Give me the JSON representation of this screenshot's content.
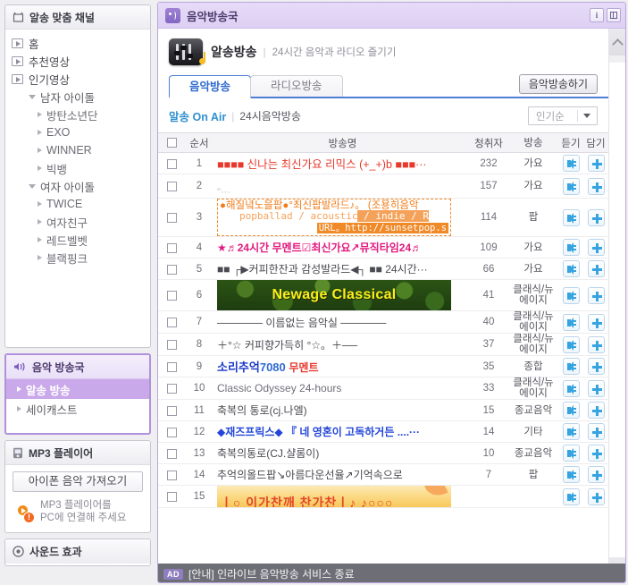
{
  "sidebar": {
    "channel_panel": {
      "title": "알송 맞춤 채널",
      "icon": "tv-icon",
      "items": [
        {
          "label": "홈",
          "level": 0,
          "icon": "tv-icon"
        },
        {
          "label": "추천영상",
          "level": 0,
          "icon": "tv-icon"
        },
        {
          "label": "인기영상",
          "level": 0,
          "icon": "tv-icon"
        },
        {
          "label": "남자 아이돌",
          "level": 1,
          "icon": "triangle-down-icon"
        },
        {
          "label": "방탄소년단",
          "level": 2,
          "icon": "triangle-right-icon"
        },
        {
          "label": "EXO",
          "level": 2,
          "icon": "triangle-right-icon"
        },
        {
          "label": "WINNER",
          "level": 2,
          "icon": "triangle-right-icon"
        },
        {
          "label": "빅뱅",
          "level": 2,
          "icon": "triangle-right-icon"
        },
        {
          "label": "여자 아이돌",
          "level": 1,
          "icon": "triangle-down-icon"
        },
        {
          "label": "TWICE",
          "level": 2,
          "icon": "triangle-right-icon"
        },
        {
          "label": "여자친구",
          "level": 2,
          "icon": "triangle-right-icon"
        },
        {
          "label": "레드벨벳",
          "level": 2,
          "icon": "triangle-right-icon"
        },
        {
          "label": "블랙핑크",
          "level": 2,
          "icon": "triangle-right-icon"
        }
      ]
    },
    "station_panel": {
      "title": "음악 방송국",
      "icon": "speaker-wave-icon",
      "items": [
        {
          "label": "알송 방송",
          "active": true
        },
        {
          "label": "세이캐스트",
          "active": false
        }
      ]
    },
    "mp3_panel": {
      "title": "MP3 플레이어",
      "icon": "mp3-device-icon",
      "import_button": "아이폰 음악 가져오기",
      "message_line1": "MP3 플레이어를",
      "message_line2": "PC에 연결해 주세요",
      "warn_glyph": "!"
    },
    "sound_panel": {
      "title": "사운드 효과",
      "icon": "sound-disc-icon"
    }
  },
  "main": {
    "window_title": "음악방송국",
    "window_buttons": [
      {
        "name": "info-button",
        "glyph": "i"
      },
      {
        "name": "layout-button",
        "glyph": ""
      }
    ],
    "station": {
      "name": "알송방송",
      "divider": "|",
      "description": "24시간 음악과 라디오 즐기기"
    },
    "tabs": [
      {
        "label": "음악방송",
        "active": true
      },
      {
        "label": "라디오방송",
        "active": false
      }
    ],
    "broadcast_button": "음악방송하기",
    "onair": {
      "label": "알송 On Air",
      "divider": "|",
      "subtitle": "24시음악방송"
    },
    "sort_select": {
      "value": "인기순"
    },
    "table": {
      "headers": {
        "check": "",
        "order": "순서",
        "name": "방송명",
        "listeners": "청취자",
        "category": "방송",
        "play": "듣기",
        "save": "담기"
      },
      "rows": [
        {
          "order": "1",
          "style": "red",
          "title": "■■■■ 신나는 최신가요 리믹스 (+_+)b ■■■···",
          "listeners": "232",
          "category": "가요"
        },
        {
          "order": "2",
          "style": "quiet",
          "title": "\"···",
          "listeners": "157",
          "category": "가요"
        },
        {
          "order": "3",
          "style": "orange-box",
          "line1": "●해질녘노을팝●°최신팝발라드♪。 (조용히음악",
          "line2_plain": "popballad / acoustic",
          "line2_hl": " / indie / R",
          "line3": "URL。http://sunsetpop.s",
          "listeners": "114",
          "category": "팝"
        },
        {
          "order": "4",
          "style": "magenta",
          "title": "★♬24시간 무멘트☑최신가요↗뮤직타임24♬",
          "listeners": "109",
          "category": "가요"
        },
        {
          "order": "5",
          "style": "dark",
          "title": "■■ ┌▶커피한잔과 감성발라드◀┐ ■■ 24시간···",
          "listeners": "66",
          "category": "가요"
        },
        {
          "order": "6",
          "style": "banner-newage",
          "title": "Newage Classical",
          "listeners": "41",
          "category": "클래식/뉴에이지"
        },
        {
          "order": "7",
          "style": "dark",
          "title": "────── 이름없는 음악실 ──────",
          "listeners": "40",
          "category": "클래식/뉴에이지"
        },
        {
          "order": "8",
          "style": "dark",
          "title": "＋°☆ 커피향가득히 °☆。＋──",
          "listeners": "37",
          "category": "클래식/뉴에이지"
        },
        {
          "order": "9",
          "style": "blue-big",
          "title_blue": "소리추억",
          "title_num": "7080",
          "title_red": "무멘트",
          "listeners": "35",
          "category": "종합"
        },
        {
          "order": "10",
          "style": "gray",
          "title": "Classic Odyssey 24-hours",
          "listeners": "33",
          "category": "클래식/뉴에이지"
        },
        {
          "order": "11",
          "style": "dark",
          "title": "축복의 통로(cj.나엘)",
          "listeners": "15",
          "category": "종교음악"
        },
        {
          "order": "12",
          "style": "blue-bold",
          "title": "◆재즈프릭스◆ 『 네 영혼이 고독하거든 ....···",
          "listeners": "14",
          "category": "기타"
        },
        {
          "order": "13",
          "style": "dark",
          "title": "축복의통로(CJ.샬롬이)",
          "listeners": "10",
          "category": "종교음악"
        },
        {
          "order": "14",
          "style": "dark",
          "title": "추억의올드팝↘아름다운선율↗기억속으로",
          "listeners": "7",
          "category": "팝"
        },
        {
          "order": "15",
          "style": "banner-last",
          "title": "ㅣ○ 이가찬깨 찬가찬ㅣ♪ ♪○○○",
          "listeners": "",
          "category": ""
        }
      ]
    }
  },
  "statusbar": {
    "badge": "AD",
    "message": "[안내] 인라이브 음악방송 서비스 종료"
  },
  "colors": {
    "accent_purple": "#b191dd",
    "active_item": "#c9a9ea",
    "tab_blue": "#4d7fd4",
    "onair_blue": "#2f8fd0",
    "icon_blue": "#35a4e0",
    "row_red": "#e8382c",
    "row_magenta": "#e2187e",
    "row_orange": "#f08a28",
    "statusbar_bg": "#6e6e76"
  }
}
